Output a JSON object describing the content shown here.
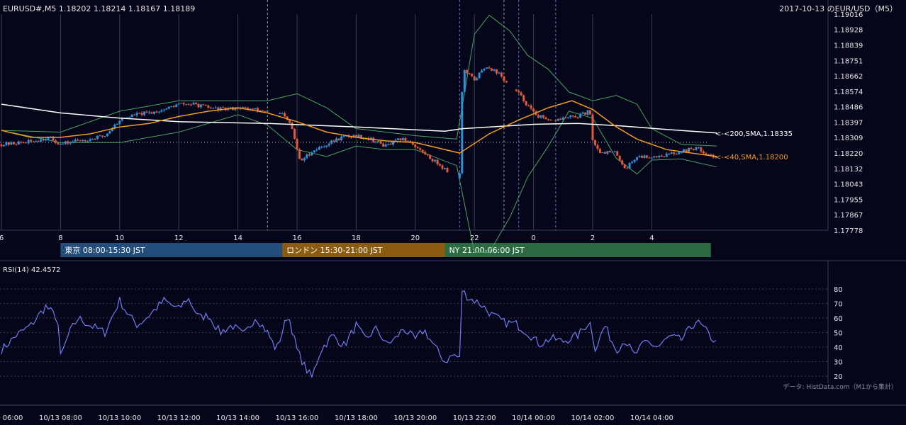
{
  "header": {
    "symbol_ohlc": "EURUSD#,M5 1.18202 1.18214 1.18167 1.18189",
    "date_title": "2017-10-13 のEUR/USD（M5）"
  },
  "colors": {
    "background": "#06061a",
    "grid": "#3b3e55",
    "candle_up": "#2f8fd8",
    "candle_down": "#e0593a",
    "sma200": "#ffffff",
    "sma40": "#f39b21",
    "bollinger": "#4aa35f",
    "rsi": "#6f7df0",
    "session_tokyo": "#234e7c",
    "session_london": "#8c5b12",
    "session_ny": "#2c6a42"
  },
  "sessions": [
    {
      "label": "東京 08:00-15:30 JST",
      "start": 8,
      "end": 15.5
    },
    {
      "label": "ロンドン 15:30-21:00 JST",
      "start": 15.5,
      "end": 21
    },
    {
      "label": "NY 21:00-06:00 JST",
      "start": 21,
      "end": 30
    }
  ],
  "footer": {
    "source": "データ: HistData.com（M1から集計）"
  },
  "chart_data": [
    {
      "type": "candlestick",
      "timeframe": "M5",
      "x_unit": "hour of day (JST), 2017-10-13; values above 24 continue into 10/14",
      "x_range": [
        6,
        30.2
      ],
      "ylim": [
        1.17778,
        1.19016
      ],
      "x_ticks": [
        "6",
        "8",
        "10",
        "12",
        "14",
        "16",
        "18",
        "20",
        "22",
        "0",
        "2",
        "4"
      ],
      "y_ticks": [
        "1.19016",
        "1.18928",
        "1.18839",
        "1.18751",
        "1.18662",
        "1.18574",
        "1.18486",
        "1.18397",
        "1.18309",
        "1.18220",
        "1.18132",
        "1.18043",
        "1.17955",
        "1.17867",
        "1.17778"
      ],
      "reference_line": 1.18282,
      "event_lines": [
        15,
        21.5,
        23,
        23.5,
        24.75
      ],
      "price_path": [
        [
          6.0,
          1.1827
        ],
        [
          7.0,
          1.18285
        ],
        [
          7.6,
          1.1831
        ],
        [
          8.0,
          1.1827
        ],
        [
          8.5,
          1.1829
        ],
        [
          9.0,
          1.183
        ],
        [
          9.5,
          1.1832
        ],
        [
          10.0,
          1.1841
        ],
        [
          10.5,
          1.1844
        ],
        [
          11.0,
          1.1845
        ],
        [
          11.5,
          1.1847
        ],
        [
          12.0,
          1.185
        ],
        [
          12.5,
          1.185
        ],
        [
          13.0,
          1.1848
        ],
        [
          13.5,
          1.1847
        ],
        [
          14.0,
          1.1848
        ],
        [
          14.5,
          1.1847
        ],
        [
          15.0,
          1.1846
        ],
        [
          15.5,
          1.1844
        ],
        [
          15.8,
          1.1838
        ],
        [
          16.1,
          1.1817
        ],
        [
          16.5,
          1.1823
        ],
        [
          17.0,
          1.1827
        ],
        [
          17.5,
          1.1831
        ],
        [
          18.0,
          1.1832
        ],
        [
          18.5,
          1.183
        ],
        [
          19.0,
          1.1826
        ],
        [
          19.5,
          1.183
        ],
        [
          19.8,
          1.1829
        ],
        [
          20.2,
          1.1823
        ],
        [
          20.6,
          1.1818
        ],
        [
          21.0,
          1.1813
        ],
        [
          21.4,
          1.1807
        ],
        [
          21.52,
          1.1811
        ],
        [
          21.6,
          1.187
        ],
        [
          22.0,
          1.1864
        ],
        [
          22.4,
          1.1872
        ],
        [
          22.8,
          1.1868
        ],
        [
          23.1,
          1.1862
        ],
        [
          23.5,
          1.1856
        ],
        [
          24.0,
          1.1845
        ],
        [
          24.5,
          1.184
        ],
        [
          25.0,
          1.1842
        ],
        [
          25.5,
          1.1843
        ],
        [
          25.9,
          1.1846
        ],
        [
          26.0,
          1.183
        ],
        [
          26.2,
          1.1823
        ],
        [
          26.8,
          1.1822
        ],
        [
          27.1,
          1.1813
        ],
        [
          27.5,
          1.182
        ],
        [
          28.0,
          1.182
        ],
        [
          28.5,
          1.1821
        ],
        [
          29.0,
          1.1823
        ],
        [
          29.5,
          1.1825
        ],
        [
          30.2,
          1.18189
        ]
      ],
      "sma200": {
        "name": "<-<200,SMA,1.18335",
        "points": [
          [
            6,
            1.185
          ],
          [
            8,
            1.1845
          ],
          [
            10,
            1.1842
          ],
          [
            12,
            1.184
          ],
          [
            15,
            1.1839
          ],
          [
            18,
            1.1837
          ],
          [
            21,
            1.18345
          ],
          [
            21.6,
            1.1836
          ],
          [
            24,
            1.18385
          ],
          [
            25.5,
            1.1839
          ],
          [
            27,
            1.18375
          ],
          [
            28.5,
            1.18355
          ],
          [
            30.2,
            1.18335
          ]
        ]
      },
      "sma40": {
        "name": "<-<40,SMA,1.18200",
        "points": [
          [
            6,
            1.1835
          ],
          [
            7,
            1.1831
          ],
          [
            8,
            1.1831
          ],
          [
            9,
            1.1833
          ],
          [
            10,
            1.1837
          ],
          [
            11,
            1.1839
          ],
          [
            12,
            1.1843
          ],
          [
            13,
            1.1846
          ],
          [
            14,
            1.1848
          ],
          [
            15,
            1.1845
          ],
          [
            16,
            1.184
          ],
          [
            17,
            1.1834
          ],
          [
            18,
            1.1831
          ],
          [
            19,
            1.1829
          ],
          [
            20,
            1.1828
          ],
          [
            21.5,
            1.1822
          ],
          [
            22.5,
            1.1833
          ],
          [
            23.5,
            1.1841
          ],
          [
            24.5,
            1.1848
          ],
          [
            25.3,
            1.1852
          ],
          [
            26,
            1.1847
          ],
          [
            26.8,
            1.1837
          ],
          [
            27.5,
            1.183
          ],
          [
            28.5,
            1.1824
          ],
          [
            30.2,
            1.182
          ]
        ]
      },
      "bollinger_upper": [
        [
          6,
          1.1835
        ],
        [
          8,
          1.1834
        ],
        [
          10,
          1.1846
        ],
        [
          12,
          1.1852
        ],
        [
          14,
          1.1852
        ],
        [
          15,
          1.1852
        ],
        [
          16,
          1.1856
        ],
        [
          17,
          1.1848
        ],
        [
          18,
          1.1836
        ],
        [
          19,
          1.1834
        ],
        [
          20,
          1.1832
        ],
        [
          21.4,
          1.183
        ],
        [
          22,
          1.189
        ],
        [
          22.5,
          1.1901
        ],
        [
          23.2,
          1.1892
        ],
        [
          23.8,
          1.1878
        ],
        [
          24.5,
          1.187
        ],
        [
          25.2,
          1.1857
        ],
        [
          26,
          1.1852
        ],
        [
          26.8,
          1.1855
        ],
        [
          27.5,
          1.185
        ],
        [
          28,
          1.1836
        ],
        [
          29,
          1.1827
        ],
        [
          30.2,
          1.1826
        ]
      ]
    },
    {
      "type": "line",
      "title": "RSI(14) 42.4572",
      "x_range": [
        6,
        30.2
      ],
      "ylim": [
        15,
        83
      ],
      "y_ticks": [
        "80",
        "70",
        "60",
        "50",
        "40",
        "30",
        "20"
      ],
      "x_ticks": [
        "10/13 06:00",
        "10/13 08:00",
        "10/13 10:00",
        "10/13 12:00",
        "10/13 14:00",
        "10/13 16:00",
        "10/13 18:00",
        "10/13 20:00",
        "10/13 22:00",
        "10/14 00:00",
        "10/14 02:00",
        "10/14 04:00"
      ],
      "x": [
        6.0,
        6.5,
        7.0,
        7.5,
        7.9,
        8.0,
        8.3,
        8.6,
        9.0,
        9.5,
        10.0,
        10.3,
        10.6,
        11.0,
        11.5,
        12.0,
        12.3,
        12.7,
        13.0,
        13.4,
        13.8,
        14.2,
        14.6,
        15.0,
        15.3,
        15.7,
        16.0,
        16.3,
        16.5,
        16.8,
        17.2,
        17.6,
        18.0,
        18.3,
        18.7,
        19.0,
        19.3,
        19.6,
        20.0,
        20.3,
        20.6,
        21.0,
        21.3,
        21.5,
        21.55,
        21.8,
        22.2,
        22.6,
        23.0,
        23.4,
        23.8,
        24.2,
        24.6,
        25.0,
        25.5,
        25.9,
        26.1,
        26.4,
        26.8,
        27.1,
        27.4,
        27.8,
        28.2,
        28.6,
        29.0,
        29.5,
        29.8,
        30.2
      ],
      "values": [
        38,
        48,
        55,
        68,
        60,
        33,
        50,
        60,
        55,
        50,
        72,
        62,
        55,
        62,
        72,
        66,
        74,
        60,
        62,
        50,
        55,
        48,
        61,
        50,
        38,
        63,
        38,
        25,
        19,
        38,
        48,
        41,
        55,
        45,
        53,
        42,
        45,
        53,
        45,
        52,
        42,
        30,
        35,
        32,
        80,
        74,
        70,
        62,
        57,
        56,
        50,
        42,
        46,
        44,
        48,
        58,
        38,
        55,
        38,
        45,
        34,
        44,
        40,
        47,
        45,
        58,
        52,
        42
      ]
    }
  ]
}
